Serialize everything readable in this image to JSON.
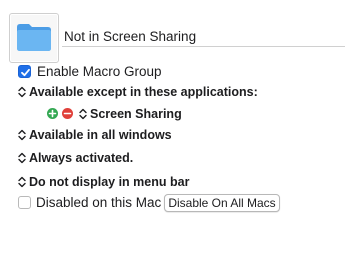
{
  "group": {
    "name": "Not in Screen Sharing",
    "icon": "folder-icon"
  },
  "enable_macro_group": {
    "label": "Enable Macro Group",
    "checked": true
  },
  "conditions": {
    "applications_popup": "Available except in these applications:",
    "applications": [
      {
        "name": "Screen Sharing"
      }
    ],
    "windows_popup": "Available in all windows",
    "activation_popup": "Always activated.",
    "menu_bar_popup": "Do not display in menu bar"
  },
  "disabled_on_mac": {
    "label": "Disabled on this Mac",
    "checked": false
  },
  "disable_all_button": {
    "label": "Disable On All Macs"
  },
  "colors": {
    "accent": "#1f6fe8",
    "folder": "#5aa9ec",
    "add": "#34a853",
    "remove": "#e0403a"
  }
}
